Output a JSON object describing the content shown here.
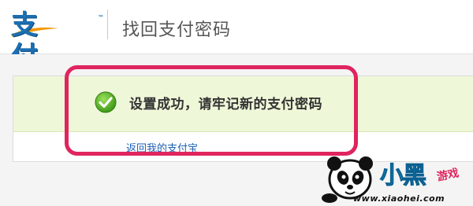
{
  "header": {
    "logo_text": "支付宝",
    "logo_tm": "™",
    "title": "找回支付密码"
  },
  "result": {
    "message": "设置成功，请牢记新的支付密码",
    "status_icon": "check-circle-icon",
    "return_link": "返回我的支付宝"
  },
  "watermark": {
    "title": "小黑",
    "subtitle": "游戏",
    "url": "www.xiaohei.com"
  },
  "colors": {
    "brand": "#1b6fb3",
    "success_band": "#eef7d8",
    "highlight": "#e0245f",
    "link": "#1a5fb4",
    "check": "#4caf1f"
  }
}
